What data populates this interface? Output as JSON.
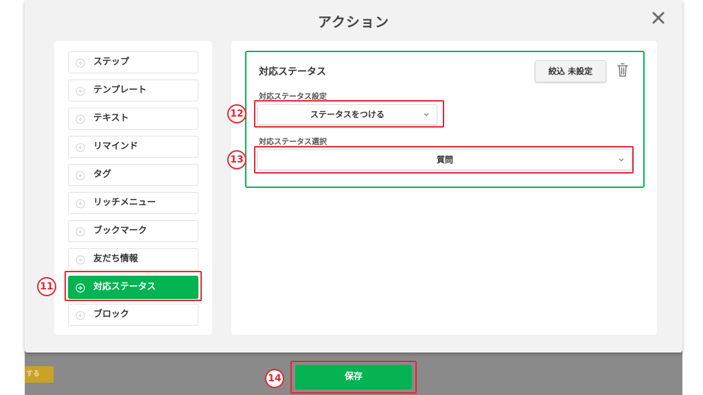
{
  "modal": {
    "title": "アクション"
  },
  "action_list": [
    {
      "label": "ステップ",
      "active": false
    },
    {
      "label": "テンプレート",
      "active": false
    },
    {
      "label": "テキスト",
      "active": false
    },
    {
      "label": "リマインド",
      "active": false
    },
    {
      "label": "タグ",
      "active": false
    },
    {
      "label": "リッチメニュー",
      "active": false
    },
    {
      "label": "ブックマーク",
      "active": false
    },
    {
      "label": "友だち情報",
      "active": false
    },
    {
      "label": "対応ステータス",
      "active": true
    },
    {
      "label": "ブロック",
      "active": false
    }
  ],
  "status_card": {
    "title": "対応ステータス",
    "filter_label": "絞込 未設定",
    "setting_label": "対応ステータス設定",
    "setting_value": "ステータスをつける",
    "select_label": "対応ステータス選択",
    "select_value": "質問"
  },
  "badges": {
    "b11": "11",
    "b12": "12",
    "b13": "13",
    "b14": "14"
  },
  "footer": {
    "save_label": "保存",
    "background_button_text": "する"
  },
  "colors": {
    "accent": "#06b352",
    "highlight": "#e8242f"
  },
  "icons": {
    "close": "close-icon",
    "trash": "trash-icon",
    "add": "plus-circle-icon",
    "dropdown": "chevron-down-icon"
  }
}
